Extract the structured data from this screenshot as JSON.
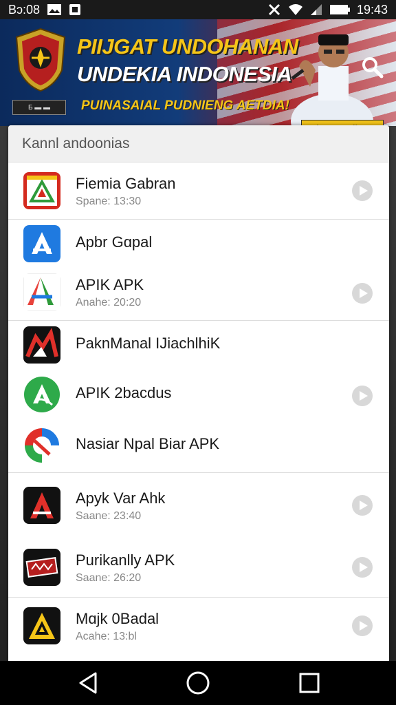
{
  "status_bar": {
    "time_left": "Bɔ:08",
    "time_right": "19:43",
    "icons": [
      "gallery-icon",
      "app-icon",
      "no-signal-icon",
      "wifi-icon",
      "signal-icon",
      "battery-icon"
    ]
  },
  "banner": {
    "line1": "PIIJGAT UNDOHANAN",
    "line2": "UNDEKIA INDONESIA",
    "line3": "PUINASAIAL PUDNIENG AETDIA!",
    "name_tag": "Ibonaa ı Illaae",
    "badge": "Ƃ ▬ ▬"
  },
  "dialog": {
    "title": "Kannl andoonias"
  },
  "apps": [
    {
      "name": "Fiemia Gabran",
      "sub": "Spane: 13:30",
      "has_play": true,
      "icon": "red-a-triangle-icon"
    },
    {
      "name": "Apbr Gɑpal",
      "sub": "",
      "has_play": false,
      "icon": "blue-a-icon"
    },
    {
      "name": "APIK APK",
      "sub": "Anahe: 20:20",
      "has_play": true,
      "icon": "colorful-a-icon"
    },
    {
      "name": "PaknManal IJiachlhiK",
      "sub": "",
      "has_play": false,
      "icon": "dark-red-arrow-icon"
    },
    {
      "name": "APIK 2bacdus",
      "sub": "",
      "has_play": true,
      "icon": "green-a-icon"
    },
    {
      "name": "Nasiar Npal Biar APK",
      "sub": "",
      "has_play": false,
      "icon": "google-style-icon"
    },
    {
      "name": "Apyk Var Ahk",
      "sub": "Saane: 23:40",
      "has_play": true,
      "icon": "black-red-a-icon"
    },
    {
      "name": "Purikanlly APK",
      "sub": "Saane: 26:20",
      "has_play": true,
      "icon": "black-badge-icon"
    },
    {
      "name": "Mɑjk 0Badal",
      "sub": "Acahe: 13:bl",
      "has_play": true,
      "icon": "yellow-a-icon"
    }
  ],
  "nav": [
    "back-icon",
    "home-icon",
    "recents-icon"
  ]
}
